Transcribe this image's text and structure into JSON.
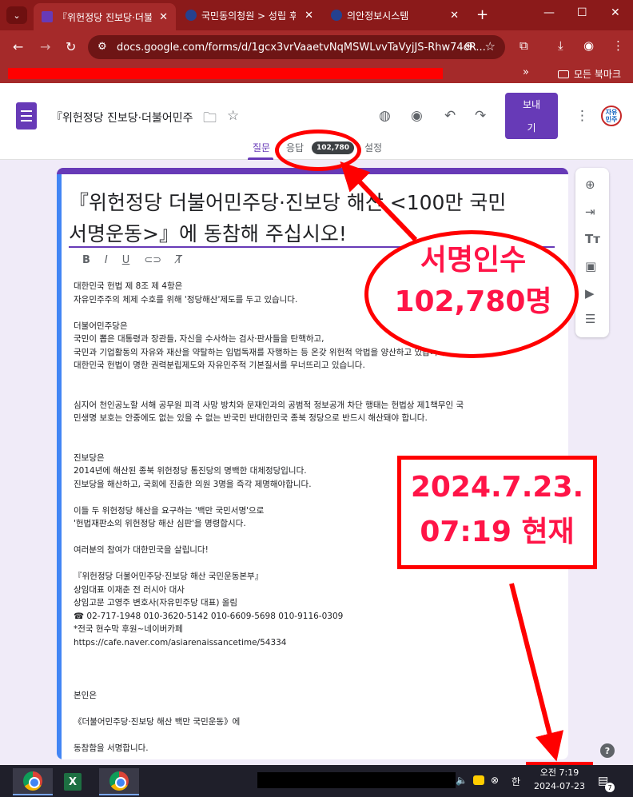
{
  "browser": {
    "tabs": [
      {
        "label": "『위헌정당 진보당·더불어",
        "active": true
      },
      {
        "label": "국민동의청원 > 성립 후",
        "active": false
      },
      {
        "label": "의안정보시스템",
        "active": false
      }
    ],
    "url": "docs.google.com/forms/d/1gcx3vrVaaetvNqMSWLvvTaVyjJS-Rhw74cR...",
    "bookmarks_folder": "모든 북마크"
  },
  "forms": {
    "doc_title": "『위헌정당 진보당·더불어민주",
    "send_label_1": "보내",
    "send_label_2": "기",
    "avatar_text": "자유민주",
    "tabs": {
      "questions": "질문",
      "responses": "응답",
      "settings": "설정"
    },
    "response_count": "102,780"
  },
  "form": {
    "title_line1": "『위헌정당 더불어민주당·진보당 해산 <100만 국민",
    "title_line2": "서명운동>』에 동참해 주십시오!",
    "description": [
      "대한민국 헌법 제 8조 제 4항은",
      "자유민주주의 체제 수호를 위해 '정당해산'제도를 두고 있습니다.",
      "",
      "더불어민주당은",
      "국민이 뽑은 대통령과 장관들, 자신을 수사하는 검사·판사들을 탄핵하고,",
      "국민과 기업활동의 자유와 재산을 약탈하는 입법독재를 자행하는 등 온갖 위헌적 악법을 양산하고 있습니다.",
      "대한민국 헌법이 명한 권력분립제도와 자유민주적 기본질서를 무너뜨리고 있습니다.",
      "",
      "",
      "심지어 천인공노할 서해 공무원 피격 사망 방치와 문재인과의 공범적 정보공개 차단 행태는 헌법상 제1책무인 국",
      "민생명 보호는 안중에도 없는 있을 수 없는 반국민 반대한민국 종북 정당으로 반드시 해산돼야 합니다.",
      "",
      "",
      "진보당은",
      "2014년에 해산된 종북 위헌정당 통진당의 명백한 대체정당입니다.",
      "진보당을 해산하고, 국회에 진출한 의원 3명을 즉각 제명해야합니다.",
      "",
      "이들 두 위헌정당 해산을 요구하는 '백만 국민서명'으로",
      "'헌법재판소의 위헌정당 해산 심판'을 명령합시다.",
      "",
      "여러분의 참여가 대한민국을 살립니다!",
      "",
      "『위헌정당 더불어민주당·진보당 해산 국민운동본부』",
      "상임대표 이재춘 전 러시아 대사",
      "상임고문 고영주 변호사(자유민주당 대표) 올림",
      "☎ 02-717-1948  010-3620-5142  010-6609-5698  010-9116-0309",
      "*전국 현수막 후원~네이버카페",
      "https://cafe.naver.com/asiarenaissancetime/54334",
      "",
      "",
      "",
      " 본인은",
      "",
      "《더불어민주당·진보당 해산 백만 국민운동》에",
      "",
      "동참함을 서명합니다."
    ]
  },
  "annotations": {
    "signatures_line1": "서명인수",
    "signatures_line2": "102,780명",
    "datetime_line1": "2024.7.23.",
    "datetime_line2": "07:19  현재",
    "color": "#ff1447"
  },
  "taskbar": {
    "clock_time": "오전 7:19",
    "clock_date": "2024-07-23",
    "notification_count": "7"
  }
}
